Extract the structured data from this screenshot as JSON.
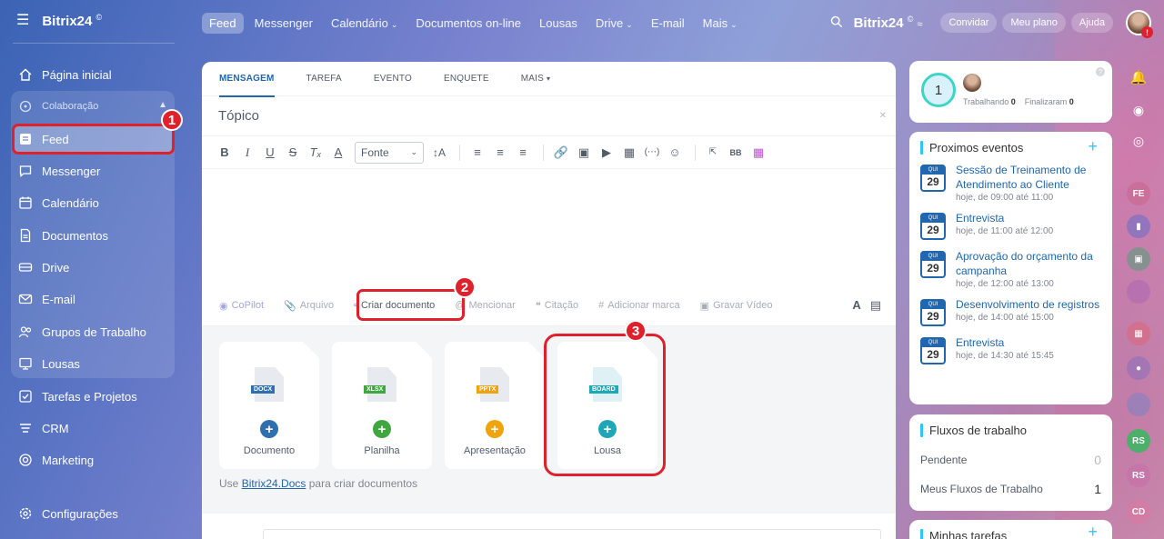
{
  "sidebar": {
    "logo": "Bitrix24",
    "logo_mark": "©",
    "items": [
      {
        "label": "Página inicial"
      },
      {
        "label": "Colaboração"
      },
      {
        "label": "Feed"
      },
      {
        "label": "Messenger"
      },
      {
        "label": "Calendário"
      },
      {
        "label": "Documentos"
      },
      {
        "label": "Drive"
      },
      {
        "label": "E-mail"
      },
      {
        "label": "Grupos de Trabalho"
      },
      {
        "label": "Lousas"
      },
      {
        "label": "Tarefas e Projetos"
      },
      {
        "label": "CRM"
      },
      {
        "label": "Marketing"
      },
      {
        "label": "Configurações"
      }
    ]
  },
  "topnav": {
    "items": [
      "Feed",
      "Messenger",
      "Calendário",
      "Documentos on-line",
      "Lousas",
      "Drive",
      "E-mail",
      "Mais"
    ],
    "brand": "Bitrix24",
    "brand_mark": "©",
    "invite": "Convidar",
    "plan": "Meu plano",
    "help": "Ajuda",
    "notif_mark": "!"
  },
  "composer": {
    "tabs": [
      "MENSAGEM",
      "TAREFA",
      "EVENTO",
      "ENQUETE",
      "MAIS"
    ],
    "topic_placeholder": "Tópico",
    "font_select": "Fonte",
    "actions": {
      "copilot": "CoPilot",
      "file": "Arquivo",
      "create_doc": "Criar documento",
      "mention": "Mencionar",
      "quote": "Citação",
      "tag": "Adicionar marca",
      "video": "Gravar Vídeo"
    },
    "cards": [
      {
        "label": "Documento",
        "tag": "DOCX",
        "color": "#2f6fb0"
      },
      {
        "label": "Planilha",
        "tag": "XLSX",
        "color": "#3ea83f"
      },
      {
        "label": "Apresentação",
        "tag": "PPTX",
        "color": "#f0a30a"
      },
      {
        "label": "Lousa",
        "tag": "BOARD",
        "color": "#1ea7b7"
      }
    ],
    "hint_prefix": "Use",
    "hint_link": "Bitrix24.Docs",
    "hint_suffix": "para criar documentos"
  },
  "annotations": [
    "1",
    "2",
    "3"
  ],
  "worktime": {
    "count": "1",
    "working_label": "Trabalhando",
    "working_count": "0",
    "finished_label": "Finalizaram",
    "finished_count": "0"
  },
  "events": {
    "title": "Proximos eventos",
    "list": [
      {
        "day_name": "QUI",
        "day": "29",
        "title": "Sessão de Treinamento de Atendimento ao Cliente",
        "time": "hoje, de 09:00 até 11:00"
      },
      {
        "day_name": "QUI",
        "day": "29",
        "title": "Entrevista",
        "time": "hoje, de 11:00 até 12:00"
      },
      {
        "day_name": "QUI",
        "day": "29",
        "title": "Aprovação do orçamento da campanha",
        "time": "hoje, de 12:00 até 13:00"
      },
      {
        "day_name": "QUI",
        "day": "29",
        "title": "Desenvolvimento de registros",
        "time": "hoje, de 14:00 até 15:00"
      },
      {
        "day_name": "QUI",
        "day": "29",
        "title": "Entrevista",
        "time": "hoje, de 14:30 até 15:45"
      }
    ]
  },
  "workflows": {
    "title": "Fluxos de trabalho",
    "pending_label": "Pendente",
    "pending_count": "0",
    "mine_label": "Meus Fluxos de Trabalho",
    "mine_count": "1"
  },
  "tasks": {
    "title": "Minhas tarefas"
  },
  "right_strip": [
    "FE",
    "RS",
    "RS",
    "CD"
  ],
  "colors": {
    "accent_red": "#e0202b",
    "link_blue": "#2067b0",
    "cyan": "#2fc6f6"
  }
}
